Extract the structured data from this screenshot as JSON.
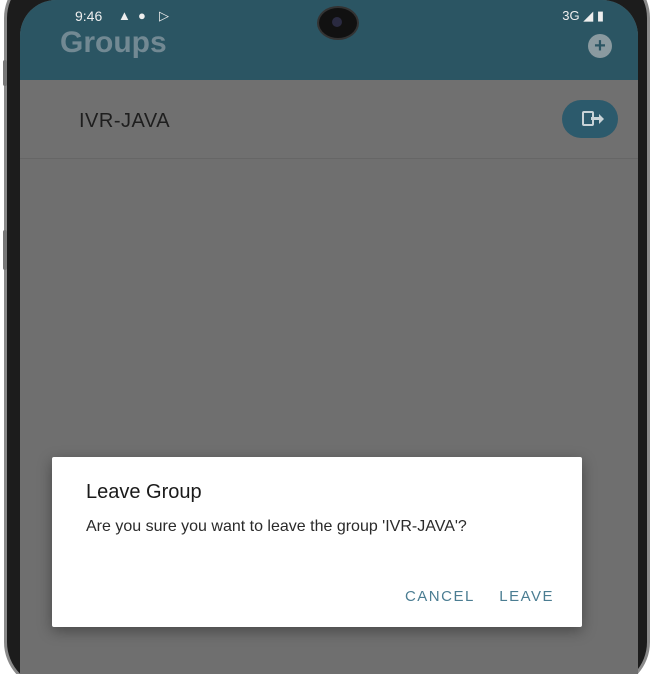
{
  "status_bar": {
    "time": "9:46",
    "icons_left": [
      "warning-icon",
      "assistant-icon",
      "play-store-icon"
    ],
    "network": "3G"
  },
  "app_bar": {
    "title": "Groups",
    "add_label": "+"
  },
  "groups": [
    {
      "name": "IVR-JAVA"
    }
  ],
  "dialog": {
    "title": "Leave Group",
    "message": "Are you sure you want to leave the group 'IVR-JAVA'?",
    "cancel_label": "CANCEL",
    "leave_label": "LEAVE"
  },
  "colors": {
    "app_bar_dimmed": "#2b5563",
    "scrim_background": "#6f6f6f",
    "accent_button_text": "#4b7d92"
  }
}
